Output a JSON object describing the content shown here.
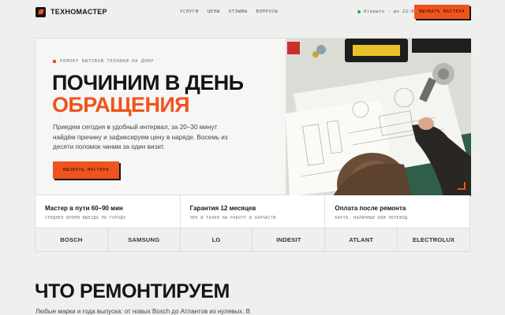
{
  "header": {
    "logo_text": "ТЕХНОМАСТЕР",
    "nav": [
      "Услуги",
      "Цены",
      "Отзывы",
      "Вопросы"
    ],
    "status_text": "Открыто · до 22:00",
    "status_color": "#2fa44f",
    "cta_label": "Вызвать мастера"
  },
  "hero": {
    "eyebrow": "Ремонт бытовой техники на дому",
    "title_line1": "Починим в день",
    "title_line2": "обращения",
    "text": "Приедем сегодня в удобный интервал, за 20–30 минут найдём причину и зафиксируем цену в наряде. Восемь из десяти поломок чиним за один визит.",
    "cta_label": "Вызвать мастера"
  },
  "stats": [
    {
      "title": "Мастер в пути 60–90 мин",
      "sub": "Среднее время выезда по городу"
    },
    {
      "title": "Гарантия 12 месяцев",
      "sub": "Чек и талон на работу и запчасти"
    },
    {
      "title": "Оплата после ремонта",
      "sub": "Карта, наличные или перевод"
    }
  ],
  "brands": [
    "BOSCH",
    "SAMSUNG",
    "LG",
    "INDESIT",
    "ATLANT",
    "ELECTROLUX"
  ],
  "section": {
    "title": "Что ремонтируем",
    "text": "Любые марки и года выпуска: от новых Bosch до Атлантов из нулевых. В"
  },
  "colors": {
    "accent": "#f0531c",
    "ink": "#151515",
    "background": "#efefed"
  }
}
